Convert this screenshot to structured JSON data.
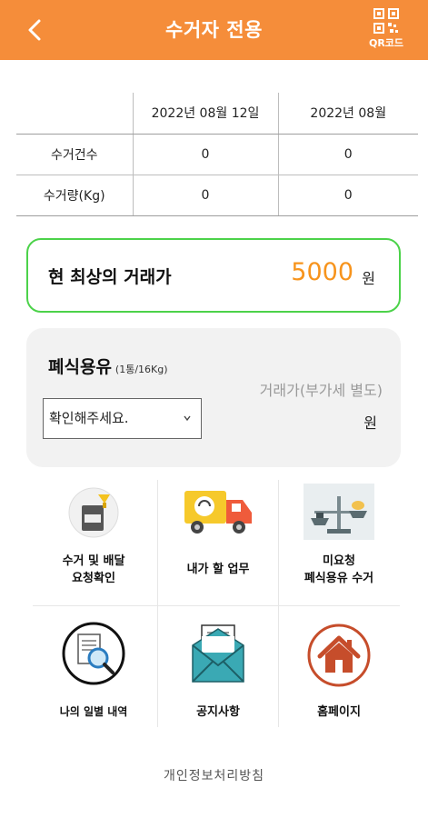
{
  "header": {
    "title": "수거자 전용",
    "qr_label": "QR코드"
  },
  "stats": {
    "columns": [
      "",
      "2022년 08월 12일",
      "2022년 08월"
    ],
    "rows": [
      {
        "label": "수거건수",
        "day": "0",
        "month": "0"
      },
      {
        "label": "수거량(Kg)",
        "day": "0",
        "month": "0"
      }
    ]
  },
  "best_price": {
    "label": "현 최상의 거래가",
    "value": "5000",
    "unit": "원",
    "accent": "#f7941d",
    "border_color": "#4cd24a"
  },
  "oil": {
    "title": "폐식용유",
    "subtitle": "(1통/16Kg)",
    "select_value": "확인해주세요.",
    "price_label": "거래가(부가세 별도)",
    "price_unit": "원"
  },
  "menu": [
    {
      "label": "수거 및 배달\n요청확인",
      "icon": "oil-container-icon"
    },
    {
      "label": "내가 할 업무",
      "icon": "delivery-truck-icon"
    },
    {
      "label": "미요청\n폐식용유 수거",
      "icon": "scale-icon"
    },
    {
      "label": "나의 일별 내역",
      "icon": "document-search-icon"
    },
    {
      "label": "공지사항",
      "icon": "envelope-icon"
    },
    {
      "label": "홈페이지",
      "icon": "home-icon"
    }
  ],
  "footer": {
    "privacy": "개인정보처리방침"
  },
  "colors": {
    "header": "#f58d3a"
  }
}
